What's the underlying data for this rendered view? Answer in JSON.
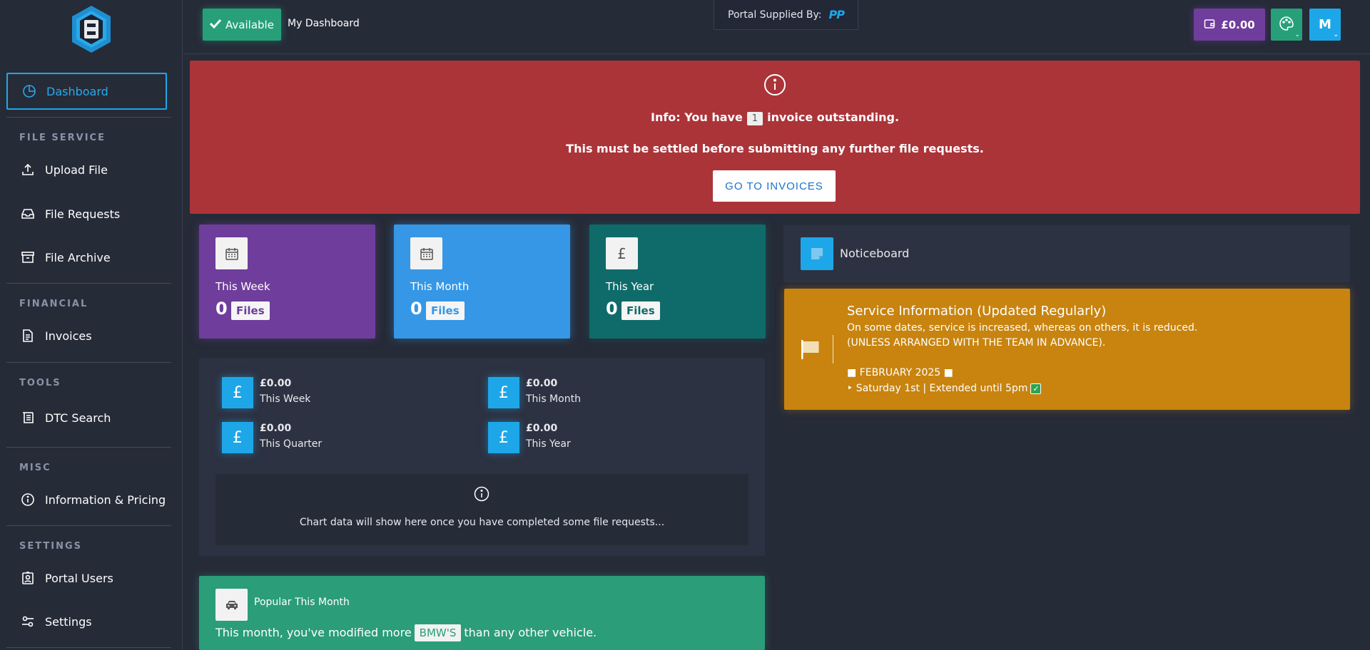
{
  "topbar": {
    "status_label": "Available",
    "page_title": "My Dashboard",
    "supplied_by": "Portal Supplied By:",
    "supplier_logo": "PP",
    "wallet_balance": "£0.00",
    "user_initial": "M"
  },
  "sidebar": {
    "dashboard": "Dashboard",
    "sections": {
      "file_service": "FILE SERVICE",
      "financial": "FINANCIAL",
      "tools": "TOOLS",
      "misc": "MISC",
      "settings": "SETTINGS"
    },
    "items": {
      "upload": "Upload File",
      "requests": "File Requests",
      "archive": "File Archive",
      "invoices": "Invoices",
      "dtc": "DTC Search",
      "info": "Information & Pricing",
      "users": "Portal Users",
      "settings": "Settings"
    }
  },
  "alert": {
    "prefix": "Info: You have",
    "count": "1",
    "suffix": "invoice outstanding.",
    "line2": "This must be settled before submitting any further file requests.",
    "button": "GO TO INVOICES"
  },
  "stats": [
    {
      "label": "This Week",
      "value": "0",
      "unit": "Files",
      "color": "#6f3d9c"
    },
    {
      "label": "This Month",
      "value": "0",
      "unit": "Files",
      "color": "#3597e6"
    },
    {
      "label": "This Year",
      "value": "0",
      "unit": "Files",
      "color": "#0e6b6a"
    }
  ],
  "finance": {
    "items": [
      {
        "amount": "£0.00",
        "label": "This Week"
      },
      {
        "amount": "£0.00",
        "label": "This Month"
      },
      {
        "amount": "£0.00",
        "label": "This Quarter"
      },
      {
        "amount": "£0.00",
        "label": "This Year"
      }
    ],
    "currency_symbol": "£",
    "chart_empty": "Chart data will show here once you have completed some file requests..."
  },
  "popular": {
    "title": "Popular This Month",
    "text_before": "This month, you've modified more",
    "vehicle": "BMW'S",
    "text_after": "than any other vehicle."
  },
  "notice": {
    "title": "Noticeboard"
  },
  "service": {
    "title": "Service Information (Updated Regularly)",
    "line1": "On some dates, service is increased, whereas on others, it is reduced.",
    "line2": "(UNLESS ARRANGED WITH THE TEAM IN ADVANCE).",
    "month": "■ FEBRUARY 2025 ■",
    "entry": "‣ Saturday 1st | Extended until 5pm"
  }
}
